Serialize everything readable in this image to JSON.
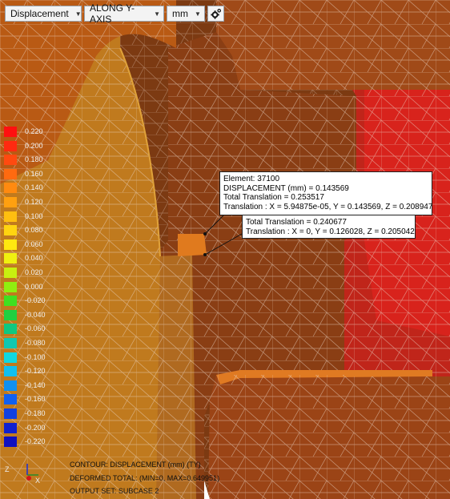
{
  "toolbar": {
    "result_type": "Displacement",
    "component": "ALONG Y-AXIS",
    "units": "mm",
    "settings_icon": "gear-icon"
  },
  "legend": {
    "labels": [
      "0.220",
      "0.200",
      "0.180",
      "0.160",
      "0.140",
      "0.120",
      "0.100",
      "0.080",
      "0.060",
      "0.040",
      "0.020",
      "0.000",
      "-0.020",
      "-0.040",
      "-0.060",
      "-0.080",
      "-0.100",
      "-0.120",
      "-0.140",
      "-0.160",
      "-0.180",
      "-0.200",
      "-0.220"
    ],
    "colors": [
      "#ff1010",
      "#ff2a10",
      "#ff4a10",
      "#ff6a10",
      "#ff8a10",
      "#ffa010",
      "#ffbe10",
      "#ffd410",
      "#ffe810",
      "#f0f010",
      "#c8f010",
      "#90ee10",
      "#40e020",
      "#20d040",
      "#10c880",
      "#10c8b0",
      "#10d8e0",
      "#10c0f0",
      "#1090f0",
      "#1060f0",
      "#1040e0",
      "#1020d0",
      "#1010c0"
    ]
  },
  "probe1": {
    "line1": "Element: 37100",
    "line2": "DISPLACEMENT (mm)  = 0.143569",
    "line3": "Total Translation = 0.253517",
    "line4": "Translation : X = 5.94875e-05, Y = 0.143569, Z = 0.208947"
  },
  "probe2": {
    "line1": "Total Translation = 0.240677",
    "line2": "Translation : X = 0, Y = 0.126028, Z = 0.205042"
  },
  "footer": {
    "line1": "CONTOUR: DISPLACEMENT (mm) (TY)",
    "line2": "DEFORMED TOTAL: (MIN=0, MAX=0.649951)",
    "line3": "OUTPUT SET: SUBCASE 2"
  },
  "triad": {
    "z_label": "Z",
    "x_label": "X"
  }
}
